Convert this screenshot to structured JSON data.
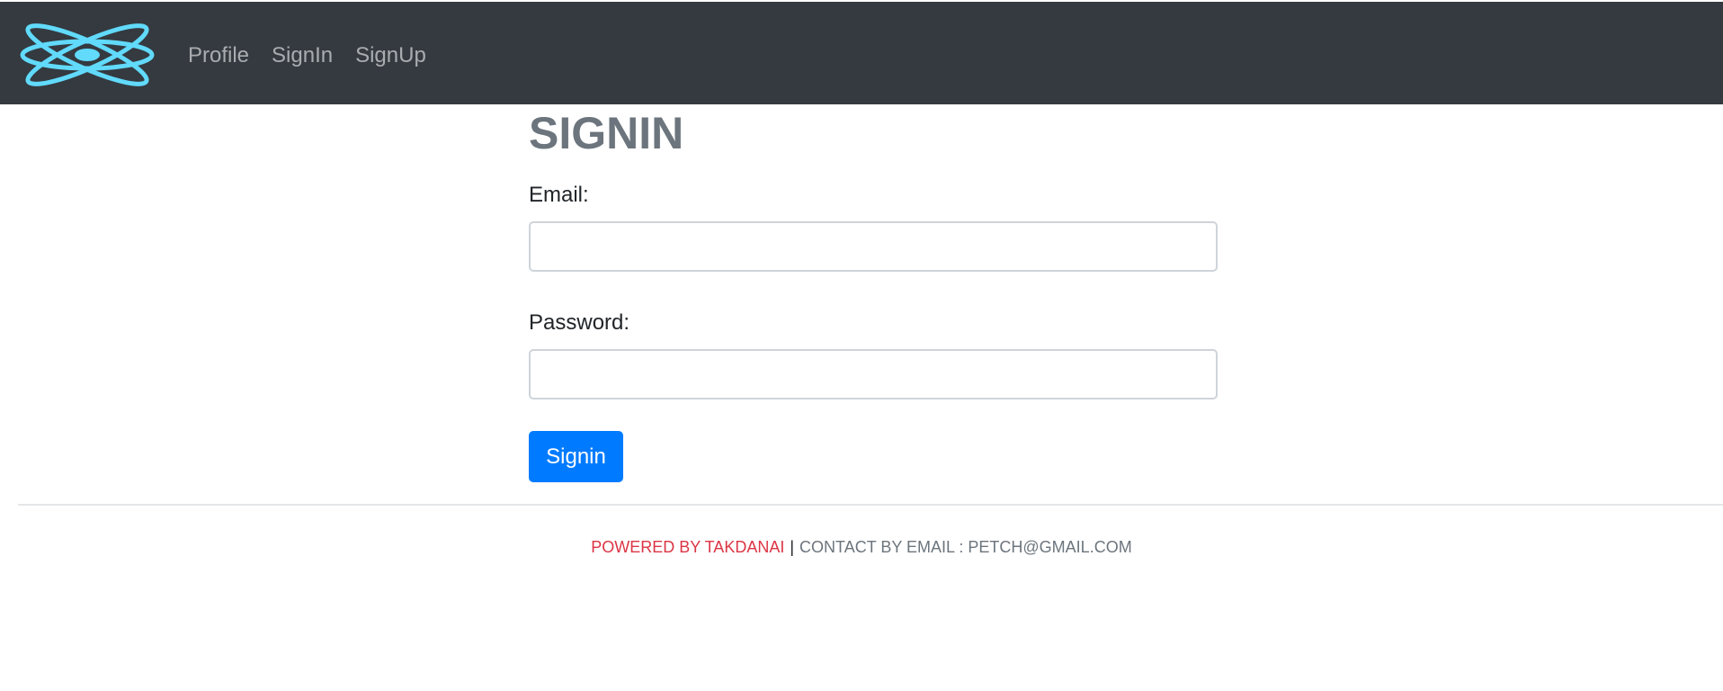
{
  "navbar": {
    "logo": "react-atom-logo",
    "links": [
      "Profile",
      "SignIn",
      "SignUp"
    ]
  },
  "form": {
    "title": "SIGNIN",
    "email_label": "Email:",
    "email_value": "",
    "password_label": "Password:",
    "password_value": "",
    "submit_label": "Signin"
  },
  "footer": {
    "powered": "POWERED BY TAKDANAI",
    "separator": "|",
    "contact": "CONTACT BY EMAIL : PETCH@GMAIL.COM"
  },
  "colors": {
    "navbar_bg": "#343a40",
    "logo": "#61dafb",
    "primary_button": "#007bff",
    "title": "#6c757d",
    "footer_powered": "#dc3545",
    "footer_contact": "#6c757d"
  }
}
